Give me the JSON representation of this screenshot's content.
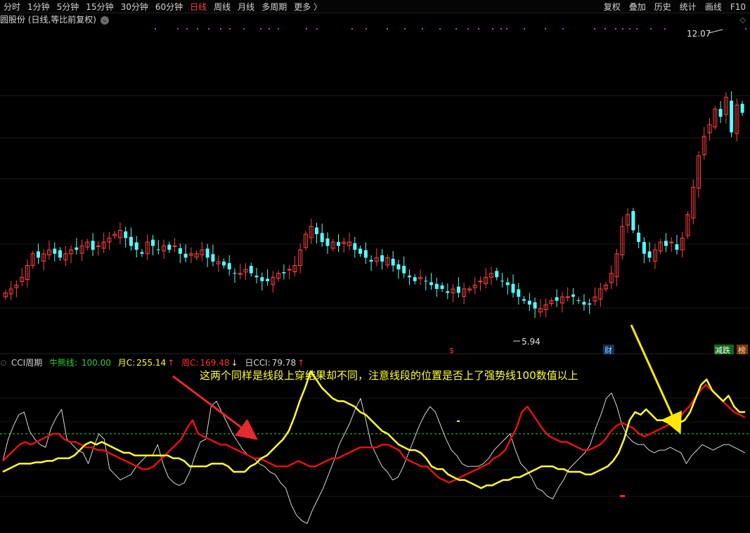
{
  "toolbar": {
    "periods": [
      "分时",
      "1分钟",
      "5分钟",
      "15分钟",
      "30分钟",
      "60分钟",
      "日线",
      "周线",
      "月线",
      "多周期",
      "更多 〉"
    ],
    "active_period": "日线",
    "tools": [
      "复权",
      "叠加",
      "历史",
      "统计",
      "画线",
      "F10"
    ]
  },
  "stock": {
    "title": "圆股份 (日线,等比前复权)"
  },
  "indicator": {
    "name": "CCI周期",
    "strong_line_label": "牛熊线:",
    "strong_line_value": "100.00",
    "month_label": "月C:",
    "month_value": "255.14",
    "week_label": "周C:",
    "week_value": "169.48",
    "day_label": "日CCI:",
    "day_value": "79.78"
  },
  "annotations": {
    "note": "这两个同样是线段上穿结果却不同，注意线段的位置是否上了强势线100数值以上",
    "high_label": "12.07",
    "low_label": "5.94",
    "marker_s": "$",
    "marker_cai": "财",
    "tag_jiandie": "减跌",
    "tag_bang": "榜"
  },
  "colors": {
    "up": "#ff4040",
    "down": "#54ffff",
    "yellow": "#ffff30",
    "red": "#e81010",
    "white": "#d8d8d8",
    "green_dash": "#2fcf2f",
    "arrow_red": "#e42a2a",
    "arrow_yellow": "#ffea00"
  },
  "chart_data": [
    {
      "type": "candlestick",
      "title": "",
      "extremes": {
        "high": 12.07,
        "low": 5.94
      },
      "close_series": [
        6.5,
        6.6,
        6.7,
        6.9,
        7.2,
        7.5,
        7.4,
        7.5,
        7.6,
        7.5,
        7.4,
        7.5,
        7.6,
        7.6,
        7.7,
        7.8,
        7.6,
        7.7,
        7.8,
        7.9,
        8.0,
        8.1,
        7.9,
        7.7,
        7.6,
        7.5,
        7.8,
        7.7,
        7.6,
        7.7,
        7.6,
        7.7,
        7.5,
        7.4,
        7.5,
        7.5,
        7.6,
        7.4,
        7.3,
        7.3,
        7.2,
        7.1,
        7.0,
        7.0,
        7.1,
        7.0,
        6.9,
        6.8,
        6.8,
        6.9,
        7.0,
        7.0,
        7.1,
        7.2,
        7.6,
        8.0,
        8.2,
        8.0,
        7.8,
        7.7,
        7.8,
        7.7,
        7.8,
        7.8,
        7.6,
        7.5,
        7.4,
        7.3,
        7.4,
        7.3,
        7.4,
        7.2,
        7.1,
        7.0,
        6.9,
        6.8,
        6.9,
        6.8,
        6.7,
        6.6,
        6.6,
        6.5,
        6.6,
        6.5,
        6.6,
        6.6,
        6.7,
        6.8,
        6.9,
        7.0,
        6.9,
        6.8,
        6.7,
        6.5,
        6.4,
        6.3,
        6.2,
        6.1,
        6.1,
        6.2,
        6.3,
        6.3,
        6.4,
        6.4,
        6.4,
        6.3,
        6.2,
        6.2,
        6.4,
        6.6,
        6.7,
        7.0,
        7.5,
        8.2,
        8.5,
        8.1,
        7.8,
        7.5,
        7.4,
        7.6,
        7.8,
        7.7,
        7.8,
        7.6,
        7.9,
        8.5,
        9.2,
        10.0,
        10.5,
        10.8,
        11.2,
        11.0,
        11.5,
        10.6,
        11.3,
        11.1
      ]
    },
    {
      "type": "line",
      "title": "",
      "series": [
        {
          "name": "月C",
          "values": [
            -40,
            -30,
            -20,
            -10,
            -10,
            -10,
            -5,
            -5,
            0,
            0,
            10,
            10,
            10,
            20,
            40,
            60,
            70,
            60,
            70,
            60,
            50,
            40,
            30,
            30,
            20,
            20,
            20,
            20,
            20,
            20,
            20,
            10,
            10,
            0,
            -20,
            -20,
            -20,
            -20,
            -10,
            -10,
            -10,
            -20,
            -40,
            -40,
            -40,
            -20,
            -10,
            10,
            20,
            40,
            60,
            80,
            110,
            160,
            220,
            270,
            330,
            300,
            270,
            250,
            230,
            220,
            220,
            210,
            200,
            180,
            170,
            150,
            130,
            110,
            100,
            80,
            60,
            50,
            40,
            40,
            30,
            10,
            -20,
            -30,
            -30,
            -50,
            -60,
            -70,
            -70,
            -80,
            -90,
            -100,
            -90,
            -90,
            -80,
            -70,
            -70,
            -60,
            -60,
            -50,
            -40,
            -30,
            -20,
            -20,
            -20,
            -30,
            -30,
            -40,
            -40,
            -40,
            -50,
            -50,
            -40,
            -30,
            -20,
            0,
            30,
            80,
            150,
            180,
            170,
            190,
            170,
            150,
            150,
            140,
            130,
            140,
            150,
            180,
            230,
            280,
            300,
            260,
            240,
            220,
            240,
            200,
            180,
            180
          ]
        },
        {
          "name": "周C",
          "values": [
            0,
            20,
            40,
            60,
            70,
            60,
            70,
            80,
            90,
            100,
            100,
            80,
            70,
            70,
            60,
            50,
            50,
            40,
            40,
            30,
            20,
            10,
            0,
            -10,
            -20,
            -30,
            -30,
            -20,
            0,
            20,
            40,
            60,
            80,
            120,
            150,
            100,
            90,
            80,
            70,
            60,
            60,
            50,
            40,
            30,
            20,
            10,
            10,
            0,
            -10,
            -20,
            -20,
            -20,
            -10,
            0,
            -10,
            -20,
            -20,
            -10,
            0,
            10,
            10,
            20,
            30,
            40,
            50,
            50,
            50,
            50,
            60,
            60,
            50,
            40,
            10,
            0,
            -10,
            -20,
            -20,
            -40,
            -60,
            -70,
            -80,
            -70,
            -60,
            -50,
            -40,
            -30,
            -20,
            -10,
            10,
            20,
            40,
            80,
            120,
            180,
            200,
            170,
            140,
            110,
            90,
            80,
            70,
            70,
            60,
            50,
            40,
            40,
            50,
            60,
            80,
            110,
            130,
            140,
            130,
            120,
            100,
            90,
            100,
            110,
            120,
            130,
            140,
            150,
            180,
            200,
            230,
            260,
            280,
            260,
            240,
            220,
            200,
            180,
            170,
            160
          ]
        },
        {
          "name": "日CCI",
          "values": [
            0,
            80,
            130,
            170,
            180,
            110,
            80,
            60,
            50,
            120,
            160,
            190,
            80,
            60,
            40,
            30,
            -10,
            50,
            100,
            80,
            -30,
            -50,
            -70,
            -60,
            -50,
            -20,
            0,
            20,
            20,
            60,
            -10,
            -60,
            -80,
            -90,
            -80,
            -40,
            20,
            70,
            80,
            200,
            220,
            180,
            140,
            100,
            70,
            40,
            20,
            10,
            -10,
            -20,
            -40,
            -50,
            -80,
            -100,
            -160,
            -200,
            -220,
            -230,
            -180,
            -140,
            -100,
            -50,
            0,
            60,
            100,
            140,
            190,
            230,
            150,
            60,
            20,
            -20,
            -40,
            -70,
            -60,
            -20,
            30,
            80,
            130,
            170,
            200,
            180,
            130,
            80,
            40,
            20,
            -10,
            -20,
            -20,
            -20,
            -10,
            10,
            40,
            60,
            80,
            100,
            40,
            -10,
            -30,
            -60,
            -100,
            -110,
            -130,
            -140,
            -100,
            -70,
            -30,
            -10,
            10,
            30,
            60,
            120,
            170,
            230,
            250,
            200,
            130,
            90,
            70,
            60,
            60,
            40,
            30,
            40,
            40,
            50,
            40,
            30,
            -10,
            20,
            40,
            60,
            50,
            40,
            50,
            60,
            60,
            50,
            40,
            30
          ]
        },
        {
          "name": "牛熊线",
          "values": [
            100
          ]
        }
      ]
    }
  ]
}
